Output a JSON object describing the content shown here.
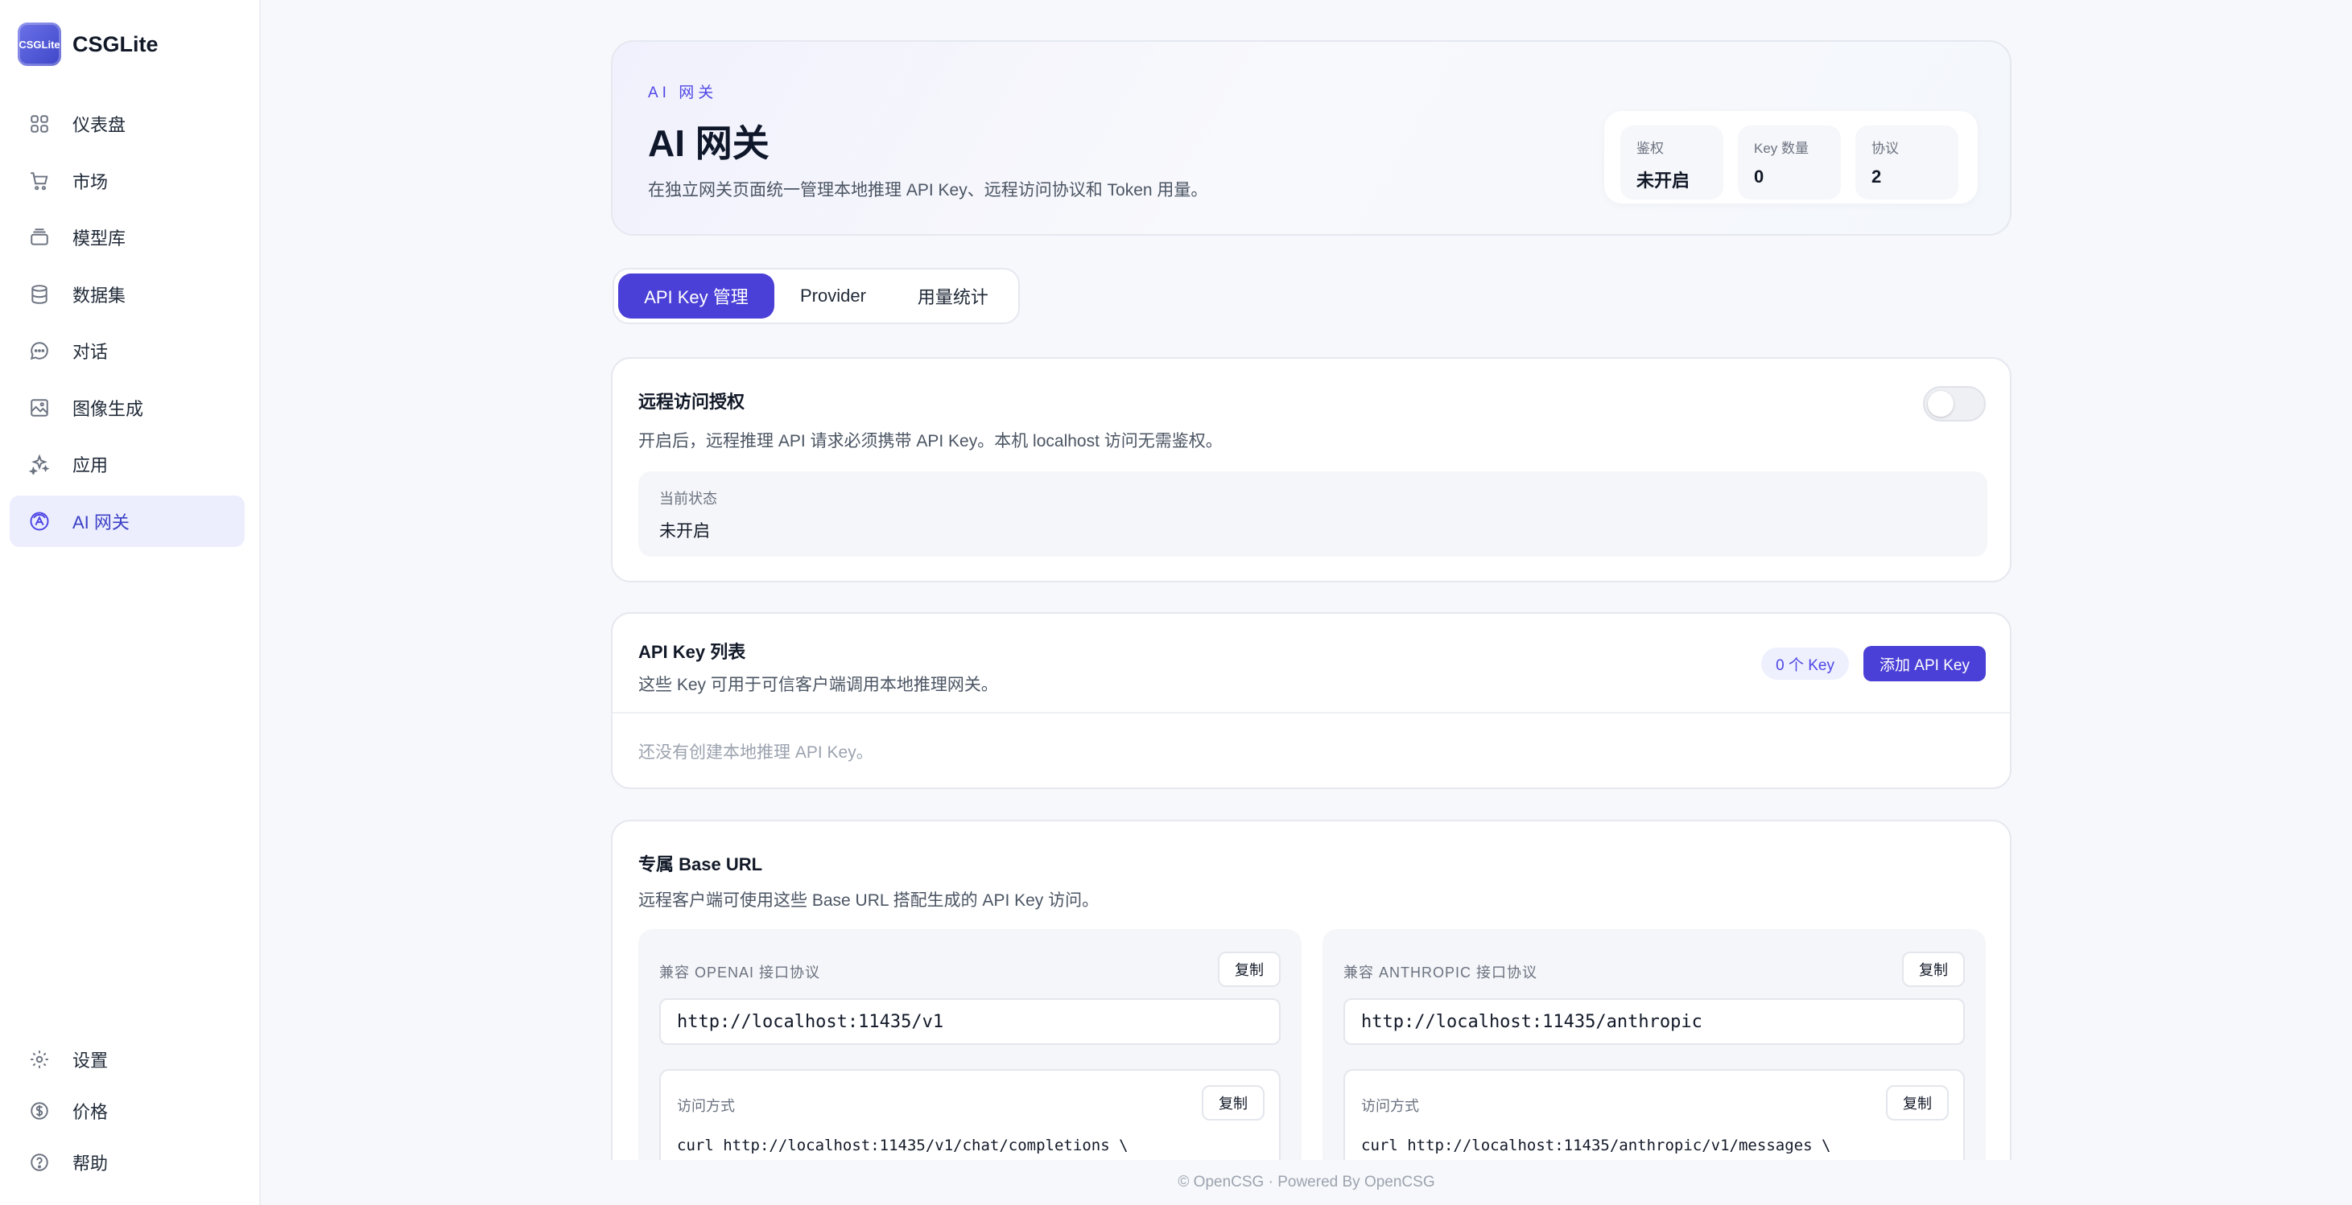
{
  "brand": {
    "logo_text": "CSGLite",
    "name": "CSGLite"
  },
  "sidebar": {
    "items": [
      {
        "label": "仪表盘",
        "icon": "dashboard-icon"
      },
      {
        "label": "市场",
        "icon": "cart-icon"
      },
      {
        "label": "模型库",
        "icon": "layers-icon"
      },
      {
        "label": "数据集",
        "icon": "database-icon"
      },
      {
        "label": "对话",
        "icon": "chat-icon"
      },
      {
        "label": "图像生成",
        "icon": "image-icon"
      },
      {
        "label": "应用",
        "icon": "sparkle-icon"
      },
      {
        "label": "AI 网关",
        "icon": "gateway-icon",
        "active": true
      }
    ],
    "bottom_items": [
      {
        "label": "设置",
        "icon": "gear-icon"
      },
      {
        "label": "价格",
        "icon": "dollar-icon"
      },
      {
        "label": "帮助",
        "icon": "help-icon"
      }
    ]
  },
  "hero": {
    "kicker": "AI 网关",
    "title": "AI 网关",
    "description": "在独立网关页面统一管理本地推理 API Key、远程访问协议和 Token 用量。",
    "stats": [
      {
        "label": "鉴权",
        "value": "未开启"
      },
      {
        "label": "Key 数量",
        "value": "0"
      },
      {
        "label": "协议",
        "value": "2"
      }
    ]
  },
  "tabs": [
    {
      "label": "API Key 管理",
      "active": true
    },
    {
      "label": "Provider"
    },
    {
      "label": "用量统计"
    }
  ],
  "remote_auth": {
    "title": "远程访问授权",
    "description": "开启后，远程推理 API 请求必须携带 API Key。本机 localhost 访问无需鉴权。",
    "enabled": false,
    "state_label": "当前状态",
    "state_value": "未开启"
  },
  "api_keys": {
    "title": "API Key 列表",
    "description": "这些 Key 可用于可信客户端调用本地推理网关。",
    "count_badge": "0 个 Key",
    "add_button": "添加 API Key",
    "empty_text": "还没有创建本地推理 API Key。"
  },
  "base_url": {
    "title": "专属 Base URL",
    "description": "远程客户端可使用这些 Base URL 搭配生成的 API Key 访问。",
    "protocols": [
      {
        "label": "兼容 OPENAI 接口协议",
        "copy": "复制",
        "url": "http://localhost:11435/v1",
        "access_label": "访问方式",
        "access_copy": "复制",
        "code": "curl http://localhost:11435/v1/chat/completions \\"
      },
      {
        "label": "兼容 ANTHROPIC 接口协议",
        "copy": "复制",
        "url": "http://localhost:11435/anthropic",
        "access_label": "访问方式",
        "access_copy": "复制",
        "code": "curl http://localhost:11435/anthropic/v1/messages \\"
      }
    ]
  },
  "footer": {
    "text": "© OpenCSG · Powered By OpenCSG"
  },
  "colors": {
    "accent": "#4a3fd6",
    "active_nav_bg": "#eceefe",
    "background": "#f7f8fb"
  }
}
